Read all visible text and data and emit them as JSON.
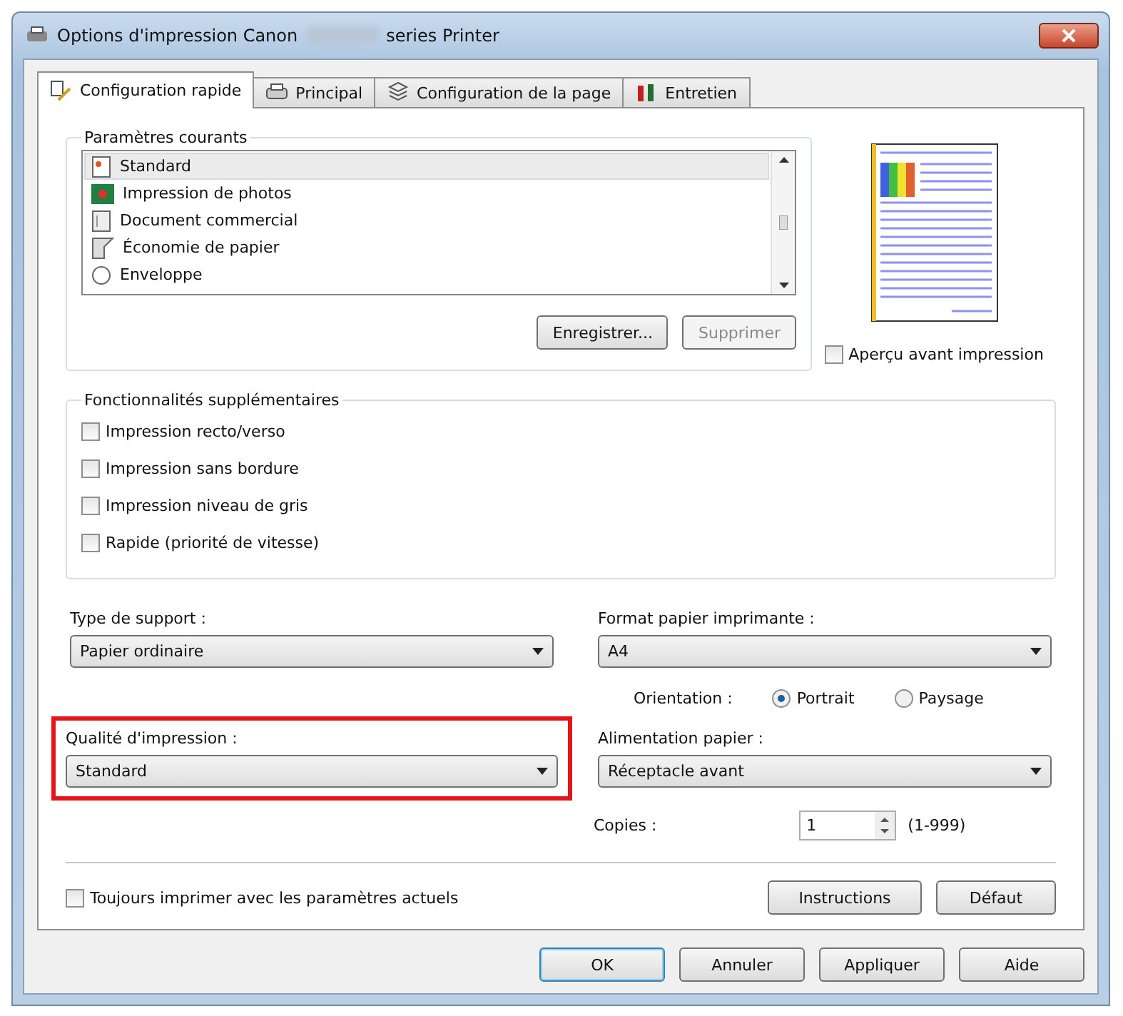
{
  "window": {
    "title_start": "Options d'impression Canon",
    "title_end": "series Printer"
  },
  "tabs": [
    {
      "label": "Configuration rapide",
      "selected": true
    },
    {
      "label": "Principal",
      "selected": false
    },
    {
      "label": "Configuration de la page",
      "selected": false
    },
    {
      "label": "Entretien",
      "selected": false
    }
  ],
  "presets": {
    "label": "Paramètres courants",
    "items": [
      {
        "label": "Standard",
        "selected": true
      },
      {
        "label": "Impression de photos",
        "selected": false
      },
      {
        "label": "Document commercial",
        "selected": false
      },
      {
        "label": "Économie de papier",
        "selected": false
      },
      {
        "label": "Enveloppe",
        "selected": false
      }
    ],
    "buttons": [
      {
        "label": "Enregistrer...",
        "disabled": false
      },
      {
        "label": "Supprimer",
        "disabled": true
      }
    ]
  },
  "preview": {
    "checkbox": {
      "label": "Aperçu avant impression",
      "checked": false
    }
  },
  "features": {
    "label": "Fonctionnalités supplémentaires",
    "items": [
      {
        "label": "Impression recto/verso",
        "checked": false
      },
      {
        "label": "Impression sans bordure",
        "checked": false
      },
      {
        "label": "Impression niveau de gris",
        "checked": false
      },
      {
        "label": "Rapide (priorité de vitesse)",
        "checked": false
      }
    ]
  },
  "media_type": {
    "label": "Type de support :",
    "value": "Papier ordinaire",
    "highlighted": false
  },
  "paper_size": {
    "label": "Format papier imprimante :",
    "value": "A4",
    "highlighted": false
  },
  "orientation": {
    "label": "Orientation :",
    "options": [
      {
        "label": "Portrait",
        "selected": true
      },
      {
        "label": "Paysage",
        "selected": false
      }
    ]
  },
  "print_quality": {
    "label": "Qualité d'impression :",
    "value": "Standard",
    "highlighted": true
  },
  "paper_source": {
    "label": "Alimentation papier :",
    "value": "Réceptacle avant",
    "highlighted": false
  },
  "copies": {
    "label": "Copies :",
    "value": "1",
    "range": "(1-999)"
  },
  "always_print": {
    "label": "Toujours imprimer avec les paramètres actuels",
    "checked": false
  },
  "panel_buttons": [
    "Instructions",
    "Défaut"
  ],
  "dialog_buttons": [
    {
      "label": "OK",
      "default": true
    },
    {
      "label": "Annuler",
      "default": false
    },
    {
      "label": "Appliquer",
      "default": false
    },
    {
      "label": "Aide",
      "default": false
    }
  ]
}
